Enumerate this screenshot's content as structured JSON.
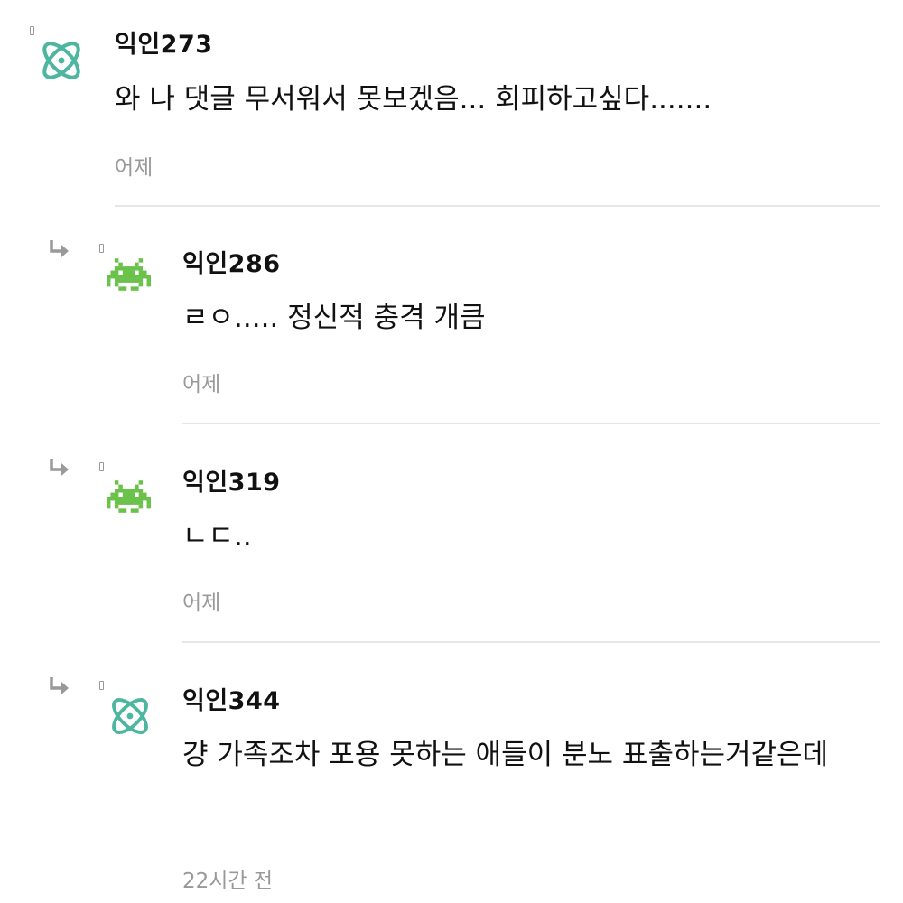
{
  "colors": {
    "background": "#ffffff",
    "text": "#111111",
    "muted": "#999999",
    "divider": "#e6e6e6",
    "atom_avatar": "#4db6a0",
    "invader_avatar": "#6ac24a"
  },
  "comments": [
    {
      "author": "익인273",
      "avatar_icon": "atom-icon",
      "is_reply": false,
      "text": "와 나 댓글 무서워서 못보겠음... 회피하고싶다.......",
      "time": "어제"
    },
    {
      "author": "익인286",
      "avatar_icon": "space-invader-icon",
      "is_reply": true,
      "text": "ㄹㅇ..... 정신적 충격 개큼",
      "time": "어제"
    },
    {
      "author": "익인319",
      "avatar_icon": "space-invader-icon",
      "is_reply": true,
      "text": "ㄴㄷ..",
      "time": "어제"
    },
    {
      "author": "익인344",
      "avatar_icon": "atom-icon",
      "is_reply": true,
      "text": "걍 가족조차 포용 못하는 애들이 분노 표출하는거같은데",
      "time": "22시간 전"
    }
  ]
}
